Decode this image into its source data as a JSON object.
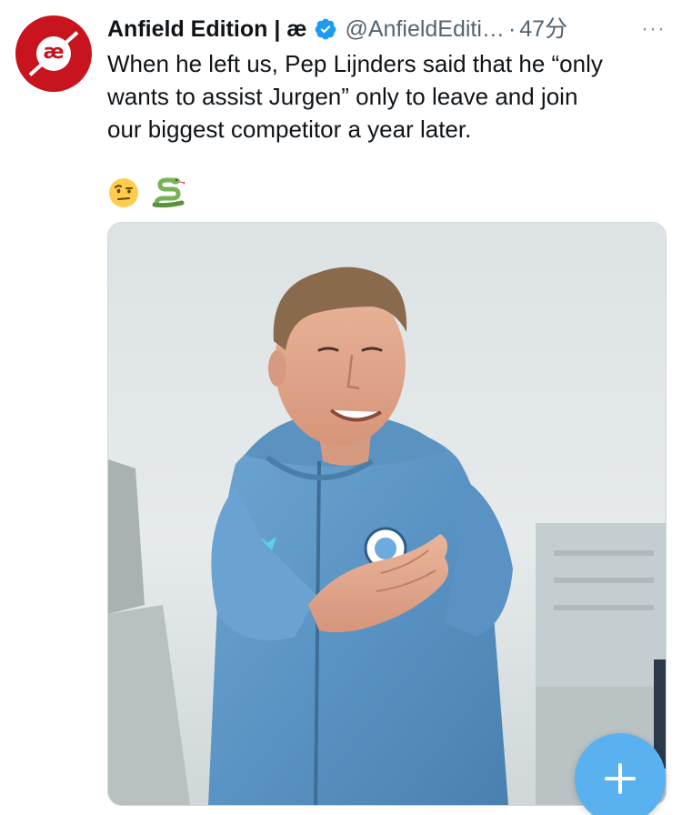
{
  "tweet": {
    "display_name": "Anfield Edition | æ",
    "handle": "@AnfieldEditi…",
    "separator": "·",
    "time": "47分",
    "more": "···",
    "text_lines": [
      "When he left us, Pep Lijnders said that he “only",
      "wants to assist Jurgen” only to leave and join",
      "our biggest competitor a year later."
    ],
    "emojis": [
      "raised-eyebrow-face",
      "snake"
    ],
    "avatar_text": "æ",
    "media": {
      "description_icon": "photo-of-smiling-coach-clapping"
    }
  },
  "colors": {
    "brand_red": "#c8141e",
    "verified_blue": "#1d9bf0",
    "fab_blue": "#5ab1ef",
    "secondary_text": "#536471"
  }
}
